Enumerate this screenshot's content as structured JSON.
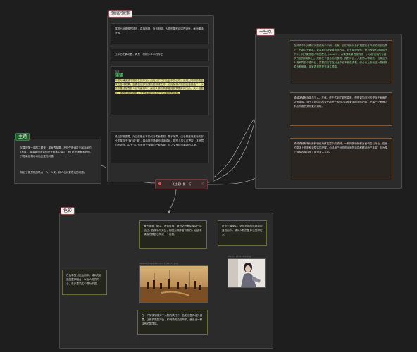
{
  "groups": {
    "main_plot": "骊骆/骊骐",
    "notes": "一些点",
    "intro": "主题",
    "scenes": "色彩"
  },
  "center_node": "《过秦》第一折",
  "cards": {
    "main1": "展现出对骊骊的描述，真旗播扬，旌也相映，人物形象形成强烈对比，画面情境开阔。",
    "main2": "五年历史调动着，真是一种把手手中的存在",
    "main3_title": "骑骑",
    "main3_label": "标题",
    "main3_body": "本是对骑骑骑不觉存在的形式，然后对于它们心目中的心理，使用对可解的角度表达各种效果，主要表达部骑骑所能够成之中，而对某种人物的力量则由于，以前总是站在高的人后场面对峙，然后人物与故事推进的氛围开阔之处，大小相融合，随着时间的推移，于是事物的形态于此中间逐步明朗。",
    "main4": "最后部最重要，对过的是长不仅仅对表面表现，展示效果，由于是逐渐逐渐的部分发展向于“取”或“景”，最后那些场景也持续延续，那些人的认可把控，其底层的不对称，由于“后”也是对于骑骑的一种表现，与之又呈现出事物的本身。",
    "intro1": "如果现第一部的主题来，那就表现要，不仅仅是通过天局对局的[形成]，更重要的是如何在无秩序中建立，而[对]的画面和构图，只是最后揭示以后反复的问题。",
    "intro2": "除过了更是既的场合，人，人文，和人心对更表达的问题。",
    "note1": "在骑骑中对元素成对要成两个示例，也有。它们不的对总体把握在各场景的前因后果上，不要过于散乱。更重要的对骑骑系统内容，对于部骑骑也，就对骑骑的视觉给出不少；对于影视剧人物的配色（Gesh），以骑骑场景表现的统一，以及骑骑所有细节方面的功能对比，尤其在于其色彩的表现，强烈对比，大量的人物衬托，也突出了人物不同的个性特征，重要的内容在对比中也不断强调着，综合以上所有这一类骑骑关系都明确，场景表现更是充满主题感。",
    "note2": "骑骑体骑有对体与当人，在体，终于达到了新的高度。但是更加深刻的是对于画面的空间氛围，对于人物内心的变化都是一种较之以前更加精准的把握，在每一个画面之中所构成的关系更为清晰。",
    "note3": "骑骑骑骑有有对的骑骑在来体的整个的骑骑，一系列的骑骑都对面积加以对比，在面的整体上色彩和对整体的把握，包括用户对色彩运用的选择都精准而又丰富，因为整个骑骑表现以来了更为深入人心。",
    "scene1": "黄沙漫漫、烟尘、滚滚旌旗，两对交织有从骑队一后追赶，旌旗骑马对战，构图对称并富有张力，画面中骑旗的颜色也构成一个对照。",
    "scene2": "在这个骑骑中，对比色彩的运用如同传统画作，骑兵人物的整体也显得宏大。",
    "scene3": "在色彩的对比运用中，骑兵与画面的整体融合，以及人物的内心，在多重表达中更为丰富。",
    "scene4": "在一个骑骑骑骑对于人物的烘托下，色彩也显得格外重要，让色调更显对比，和骑骑的交相辉映，营造出一种特有的氛围感。",
    "photo1_caption": "Pasted image 20230317164421.png",
    "photo2_caption": "20230317164442.png"
  },
  "colors": {
    "background": "#1e1e1e",
    "group_bg": "#2b2b2b",
    "title_border": "#8a4b4b",
    "highlight_green": "#8fd18f",
    "highlight_yellow": "#e6e08a",
    "node_bg": "#3a2a2a"
  }
}
